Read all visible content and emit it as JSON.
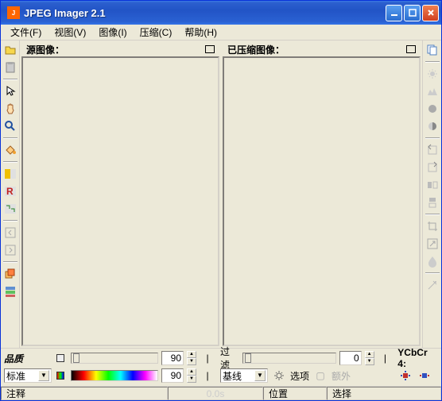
{
  "title": "JPEG Imager 2.1",
  "menu": {
    "file": "文件(F)",
    "view": "视图(V)",
    "image": "图像(I)",
    "compress": "压缩(C)",
    "help": "帮助(H)"
  },
  "panels": {
    "source": "源图像：",
    "compressed": "已压缩图像："
  },
  "bottom": {
    "quality_label": "品质",
    "standard_combo": "标准",
    "quality_value": "90",
    "secondary_value": "90",
    "filter_label": "过滤",
    "filter_value": "0",
    "baseline_combo": "基线",
    "options_label": "选项",
    "extra_label": "额外",
    "ycbcr_label": "YCbCr 4:"
  },
  "status": {
    "comment": "注释",
    "time": "0.0s",
    "position": "位置",
    "selection": "选择"
  }
}
